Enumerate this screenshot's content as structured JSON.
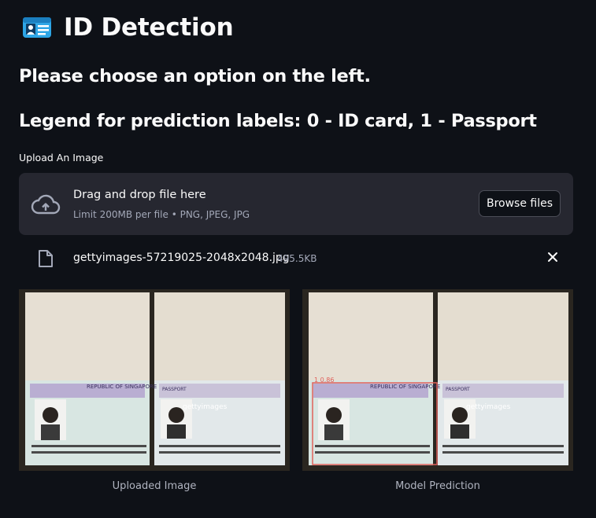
{
  "app": {
    "title": "ID Detection",
    "icon": "id-card-icon"
  },
  "instructions": {
    "choose_option": "Please choose an option on the left.",
    "legend": "Legend for prediction labels: 0 - ID card, 1 - Passport"
  },
  "uploader": {
    "label": "Upload An Image",
    "dropzone_title": "Drag and drop file here",
    "dropzone_limit": "Limit 200MB per file • PNG, JPEG, JPG",
    "browse_label": "Browse files",
    "icon": "cloud-upload-icon"
  },
  "uploaded_file": {
    "name": "gettyimages-57219025-2048x2048.jpg",
    "size": "495.5KB",
    "icon": "file-icon",
    "remove_icon": "close-icon"
  },
  "images": {
    "uploaded_caption": "Uploaded Image",
    "prediction_caption": "Model Prediction",
    "passport_header": "REPUBLIC OF SINGAPORE",
    "passport_label": "PASSPORT",
    "watermark": "gettyimages",
    "prediction_box_label": "1 0.86"
  },
  "colors": {
    "background": "#0e1117",
    "dropzone": "#262730",
    "text": "#fafafa",
    "muted": "#a3a8b8",
    "detection_box": "#e0605a"
  }
}
